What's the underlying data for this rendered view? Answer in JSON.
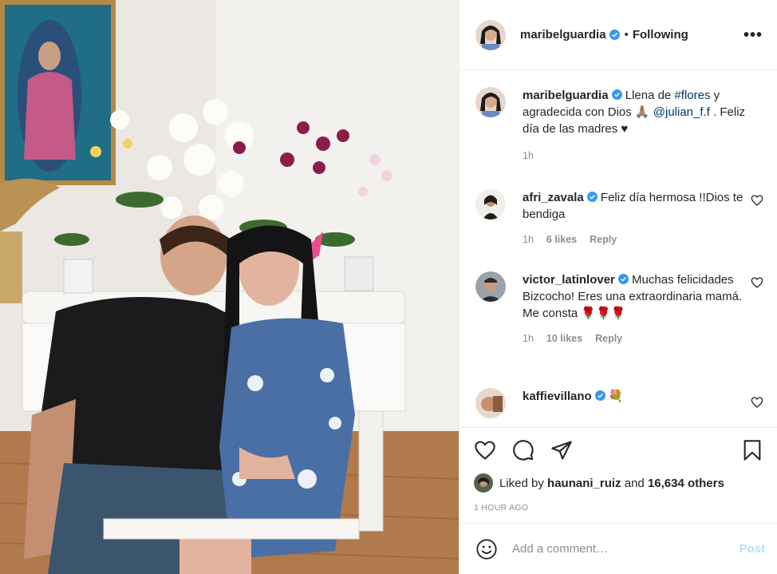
{
  "post": {
    "author": "maribelguardia",
    "following_label": "Following",
    "separator": "•",
    "more_label": "•••",
    "caption": {
      "username": "maribelguardia",
      "text_1": " Llena de ",
      "hashtag": "#flores",
      "text_2": " y agradecida con Dios 🙏🏽 ",
      "mention": "@julian_f.f",
      "text_3": " . Feliz día de las madres ♥",
      "time": "1h"
    },
    "comments": [
      {
        "username": "afri_zavala",
        "verified": true,
        "text": " Feliz día hermosa !!Dios te bendiga",
        "time": "1h",
        "likes": "6 likes",
        "reply": "Reply"
      },
      {
        "username": "victor_latinlover",
        "verified": true,
        "text": " Muchas felicidades Bizcocho! Eres una extraordinaria mamá. Me consta 🌹🌹🌹",
        "time": "1h",
        "likes": "10 likes",
        "reply": "Reply"
      },
      {
        "username": "kaffievillano",
        "verified": true,
        "text": " 💐"
      }
    ],
    "liked_by": {
      "prefix": "Liked by ",
      "user": "haunani_ruiz",
      "middle": " and ",
      "count": "16,634 others"
    },
    "time_ago": "1 HOUR AGO",
    "add_comment": {
      "placeholder": "Add a comment…",
      "post_label": "Post"
    }
  },
  "colors": {
    "verified": "#3897f0",
    "link": "#00376b",
    "muted": "#8e8e8e",
    "post_disabled": "#b2dffc"
  }
}
